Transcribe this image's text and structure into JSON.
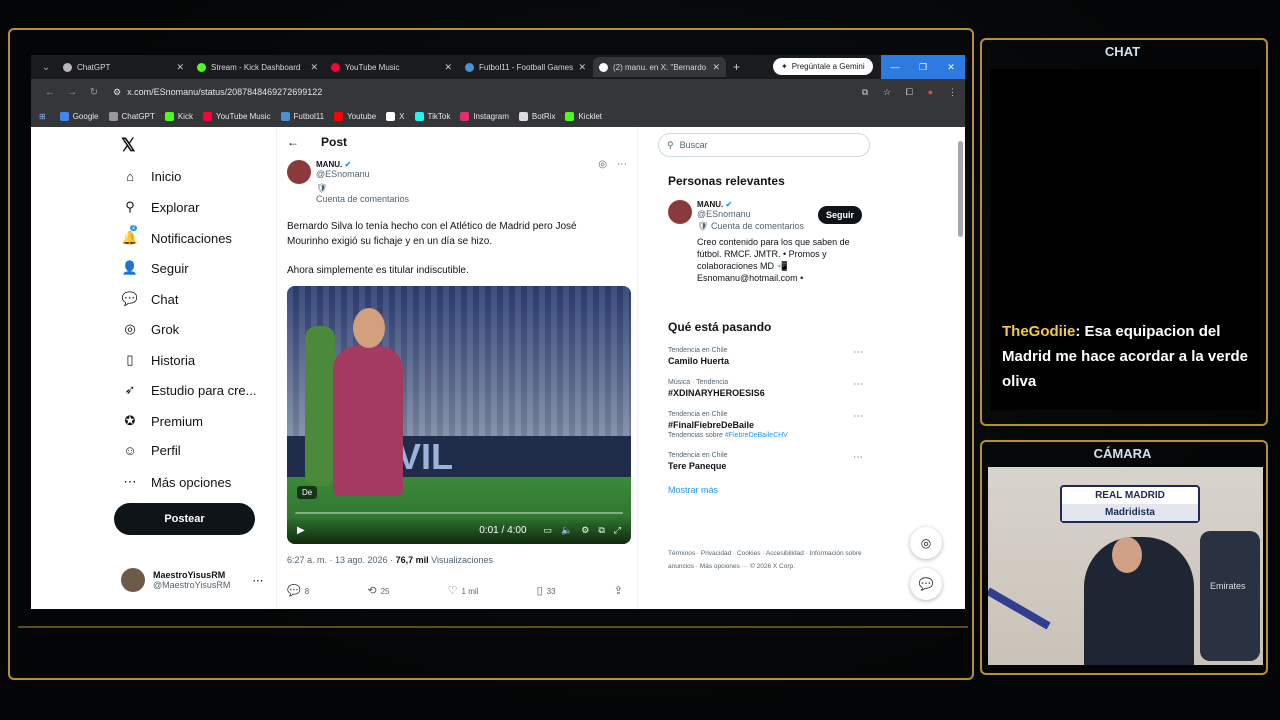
{
  "browser": {
    "tabs": [
      {
        "label": "ChatGPT",
        "color": "#b8b8b8"
      },
      {
        "label": "Stream - Kick Dashboard",
        "color": "#53fc18"
      },
      {
        "label": "YouTube Music",
        "color": "#ff0033"
      },
      {
        "label": "Futbol11 - Football Games",
        "color": "#4a90d9"
      },
      {
        "label": "(2) manu. en X: \"Bernardo S",
        "color": "#ffffff"
      }
    ],
    "gemini_label": "Pregúntale a Gemini",
    "url": "x.com/ESnomanu/status/2087848469272699122",
    "bookmarks": [
      "Google",
      "ChatGPT",
      "Kick",
      "YouTube Music",
      "Futbol11",
      "Youtube",
      "X",
      "TikTok",
      "Instagram",
      "BotRix",
      "Kicklet"
    ]
  },
  "nav": {
    "items": [
      {
        "label": "Inicio",
        "icon": "home-icon",
        "glyph": "⌂"
      },
      {
        "label": "Explorar",
        "icon": "search-icon",
        "glyph": "⚲"
      },
      {
        "label": "Notificaciones",
        "icon": "bell-icon",
        "glyph": "🔔"
      },
      {
        "label": "Seguir",
        "icon": "person-add-icon",
        "glyph": "👤"
      },
      {
        "label": "Chat",
        "icon": "chat-icon",
        "glyph": "💬"
      },
      {
        "label": "Grok",
        "icon": "grok-icon",
        "glyph": "◎"
      },
      {
        "label": "Historia",
        "icon": "bookmark-icon",
        "glyph": "▯"
      },
      {
        "label": "Estudio para cre...",
        "icon": "rocket-icon",
        "glyph": "➶"
      },
      {
        "label": "Premium",
        "icon": "verified-icon",
        "glyph": "✪"
      },
      {
        "label": "Perfil",
        "icon": "profile-icon",
        "glyph": "☺"
      },
      {
        "label": "Más opciones",
        "icon": "more-icon",
        "glyph": "⋯"
      }
    ],
    "notif_badge": "2",
    "post_button": "Postear",
    "me": {
      "name": "MaestroYisusRM",
      "handle": "@MaestroYisusRM"
    }
  },
  "post": {
    "header": "Post",
    "author": {
      "name": "MANU.",
      "handle": "@ESnomanu",
      "bio": "Cuenta de comentarios"
    },
    "text1": "Bernardo Silva lo tenía hecho con el Atlético de Madrid pero José Mourinho exigió su fichaje y en un día se hizo.",
    "text2": "Ahora simplemente es titular indiscutible.",
    "video": {
      "time": "0:01 / 4:00",
      "badge": "De",
      "board_text": "VIL",
      "progress": 0.004
    },
    "meta": {
      "time": "6:27 a. m. · 13 ago. 2026 · ",
      "views": "76,7 mil",
      "views_label": " Visualizaciones"
    },
    "actions": {
      "replies": "8",
      "reposts": "25",
      "likes": "1 mil",
      "bookmarks": "33"
    }
  },
  "sidebar": {
    "search_placeholder": "Buscar",
    "relevant_title": "Personas relevantes",
    "relevant": {
      "name": "MANU.",
      "handle": "@ESnomanu",
      "bio1": "Cuenta de comentarios",
      "bio2": "Creo contenido para los que saben de fútbol. RMCF. JMTR. • Promos y colaboraciones MD 📲 Esnomanu@hotmail.com •",
      "follow": "Seguir"
    },
    "trends_title": "Qué está pasando",
    "trends": [
      {
        "context": "Tendencia en Chile",
        "name": "Camilo Huerta",
        "sub": ""
      },
      {
        "context": "Música · Tendencia",
        "name": "#XDINARYHEROESIS6",
        "sub": ""
      },
      {
        "context": "Tendencia en Chile",
        "name": "#FinalFiebreDeBaile",
        "sub": "Tendencias sobre ",
        "sub_hl": "#FiebreDeBaileCHV"
      },
      {
        "context": "Tendencia en Chile",
        "name": "Tere Paneque",
        "sub": ""
      }
    ],
    "show_more": "Mostrar más",
    "footer": "Términos · Privacidad · Cookies · Accesibilidad · Información sobre anuncios · Más opciones ··· © 2026 X Corp."
  },
  "overlay": {
    "chat_title": "CHAT",
    "chat_user": "TheGodiie",
    "chat_text": ": Esa equipacion del Madrid me hace acordar a la verde oliva",
    "camera_title": "CÁMARA",
    "flag_line1": "REAL MADRID",
    "flag_line2": "Madridista",
    "jersey_text": "Emirates"
  }
}
